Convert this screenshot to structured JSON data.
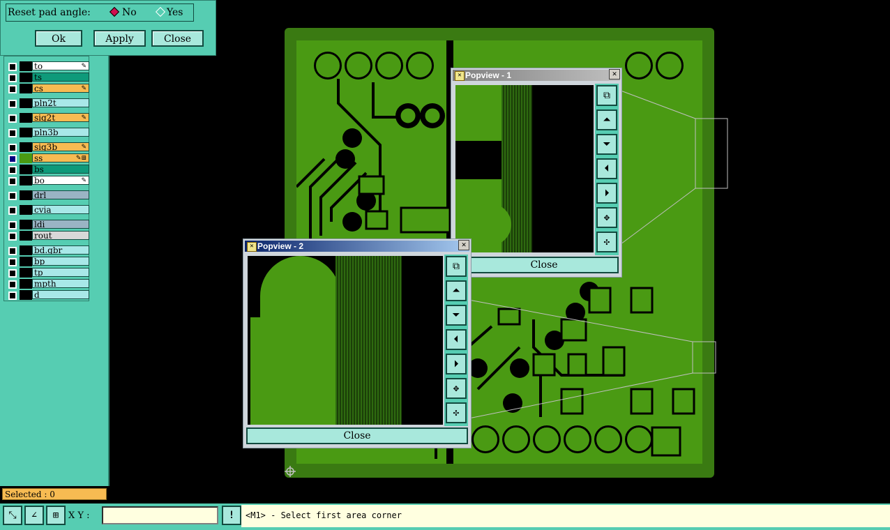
{
  "dialog": {
    "reset_label": "Reset pad angle:",
    "opt_no": "No",
    "opt_yes": "Yes",
    "ok": "Ok",
    "apply": "Apply",
    "close": "Close"
  },
  "layers": [
    {
      "name": "to",
      "color": "#ffffff",
      "mark": "✎"
    },
    {
      "name": "ts",
      "color": "#0e9a7a",
      "mark": ""
    },
    {
      "name": "cs",
      "color": "#f7bb52",
      "mark": "✎"
    },
    {
      "name": "pln2t",
      "color": "#a8e8e8",
      "mark": ""
    },
    {
      "name": "sig2t",
      "color": "#f7bb52",
      "mark": "✎"
    },
    {
      "name": "pln3b",
      "color": "#a8e8e8",
      "mark": ""
    },
    {
      "name": "sig3b",
      "color": "#f7bb52",
      "mark": "✎"
    },
    {
      "name": "ss",
      "color": "#f7bb52",
      "mark": "✎⊞"
    },
    {
      "name": "bs",
      "color": "#0e9a7a",
      "mark": ""
    },
    {
      "name": "bo",
      "color": "#ffffff",
      "mark": "✎"
    },
    {
      "name": "drl",
      "color": "#9ab4c4",
      "mark": ""
    },
    {
      "name": "cvia",
      "color": "#a8e8e8",
      "mark": ""
    },
    {
      "name": "ldi",
      "color": "#9ab4c4",
      "mark": ""
    },
    {
      "name": "rout",
      "color": "#d8d8d8",
      "mark": ""
    },
    {
      "name": "bd.gbr",
      "color": "#a8e8e8",
      "mark": ""
    },
    {
      "name": "bp",
      "color": "#a8e8e8",
      "mark": ""
    },
    {
      "name": "tp",
      "color": "#a8e8e8",
      "mark": ""
    },
    {
      "name": "mpth",
      "color": "#a8e8e8",
      "mark": ""
    },
    {
      "name": "d",
      "color": "#a8e8e8",
      "mark": ""
    }
  ],
  "popview1": {
    "title": "Popview - 1",
    "close": "Close"
  },
  "popview2": {
    "title": "Popview - 2",
    "close": "Close"
  },
  "status": {
    "selected": "Selected : 0",
    "xy_label": "X Y :",
    "xy_value": "",
    "message": "<M1> - Select first area corner"
  },
  "colors": {
    "board": "#4a9a13",
    "panel": "#56cdb2",
    "selected_bar": "#f7bb52"
  }
}
